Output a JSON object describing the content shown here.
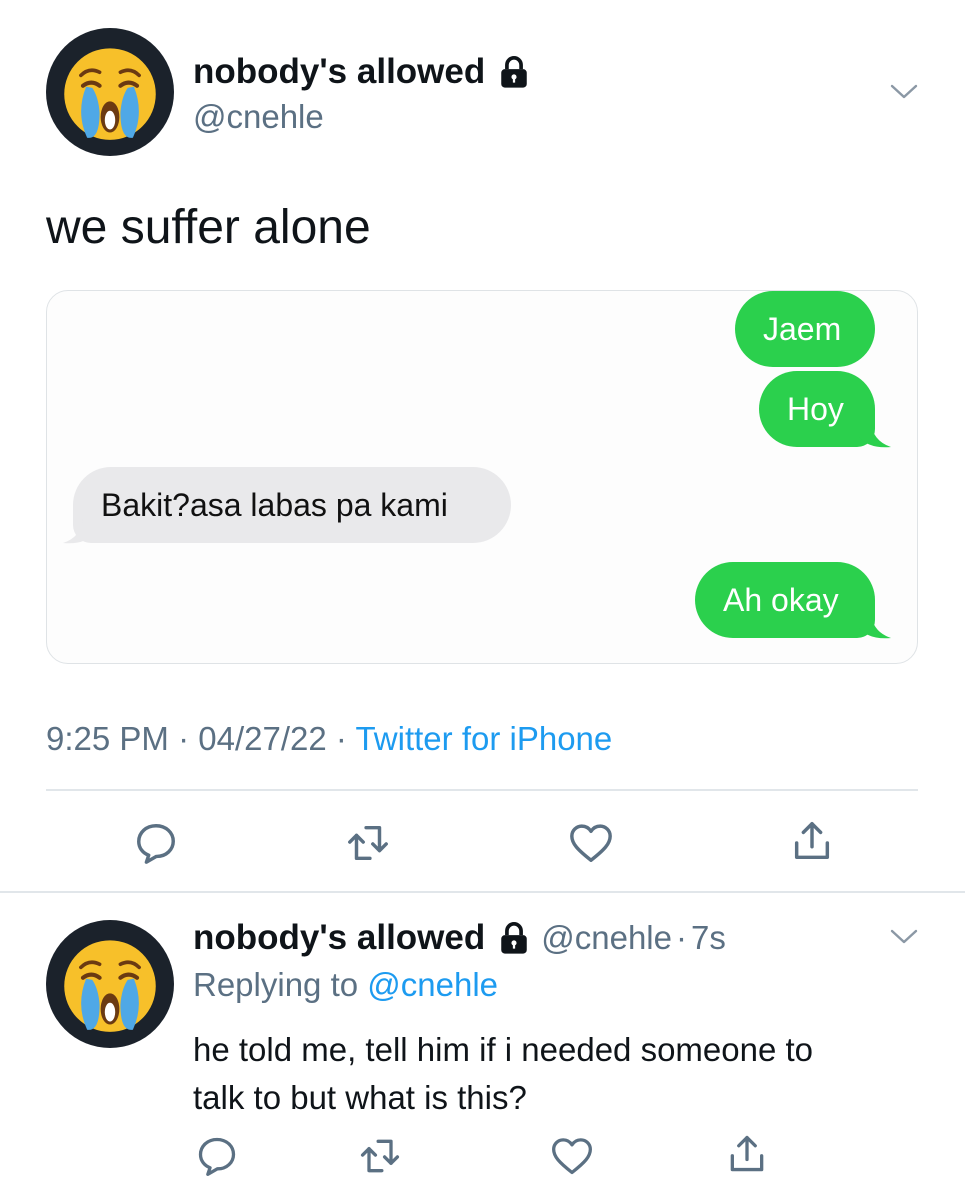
{
  "main_tweet": {
    "display_name": "nobody's allowed",
    "handle": "@cnehle",
    "text": "we suffer alone",
    "time": "9:25 PM",
    "sep1": "·",
    "date": "04/27/22",
    "sep2": "·",
    "source": "Twitter for iPhone"
  },
  "screenshot": {
    "messages": [
      {
        "side": "outgoing",
        "text": "Jaem"
      },
      {
        "side": "outgoing",
        "text": "Hoy"
      },
      {
        "side": "incoming",
        "text": "Bakit?asa labas pa kami"
      },
      {
        "side": "outgoing",
        "text": "Ah okay"
      }
    ]
  },
  "reply_tweet": {
    "display_name": "nobody's allowed",
    "handle": "@cnehle",
    "sep": "·",
    "age": "7s",
    "replying_prefix": "Replying to",
    "replying_handle": "@cnehle",
    "text_line1": "he told me, tell him if i needed someone to",
    "text_line2": "talk to but what is this?"
  },
  "icons": {
    "avatar": "loudly-crying-face-icon",
    "protected": "lock-icon",
    "menu": "chevron-down-icon",
    "reply": "comment-icon",
    "retweet": "retweet-icon",
    "like": "heart-icon",
    "share": "share-icon"
  },
  "colors": {
    "text": "#0f1419",
    "muted": "#5b7083",
    "link": "#1d9bf0",
    "imessage_out": "#2bd04d",
    "imessage_in": "#e9e9eb"
  }
}
